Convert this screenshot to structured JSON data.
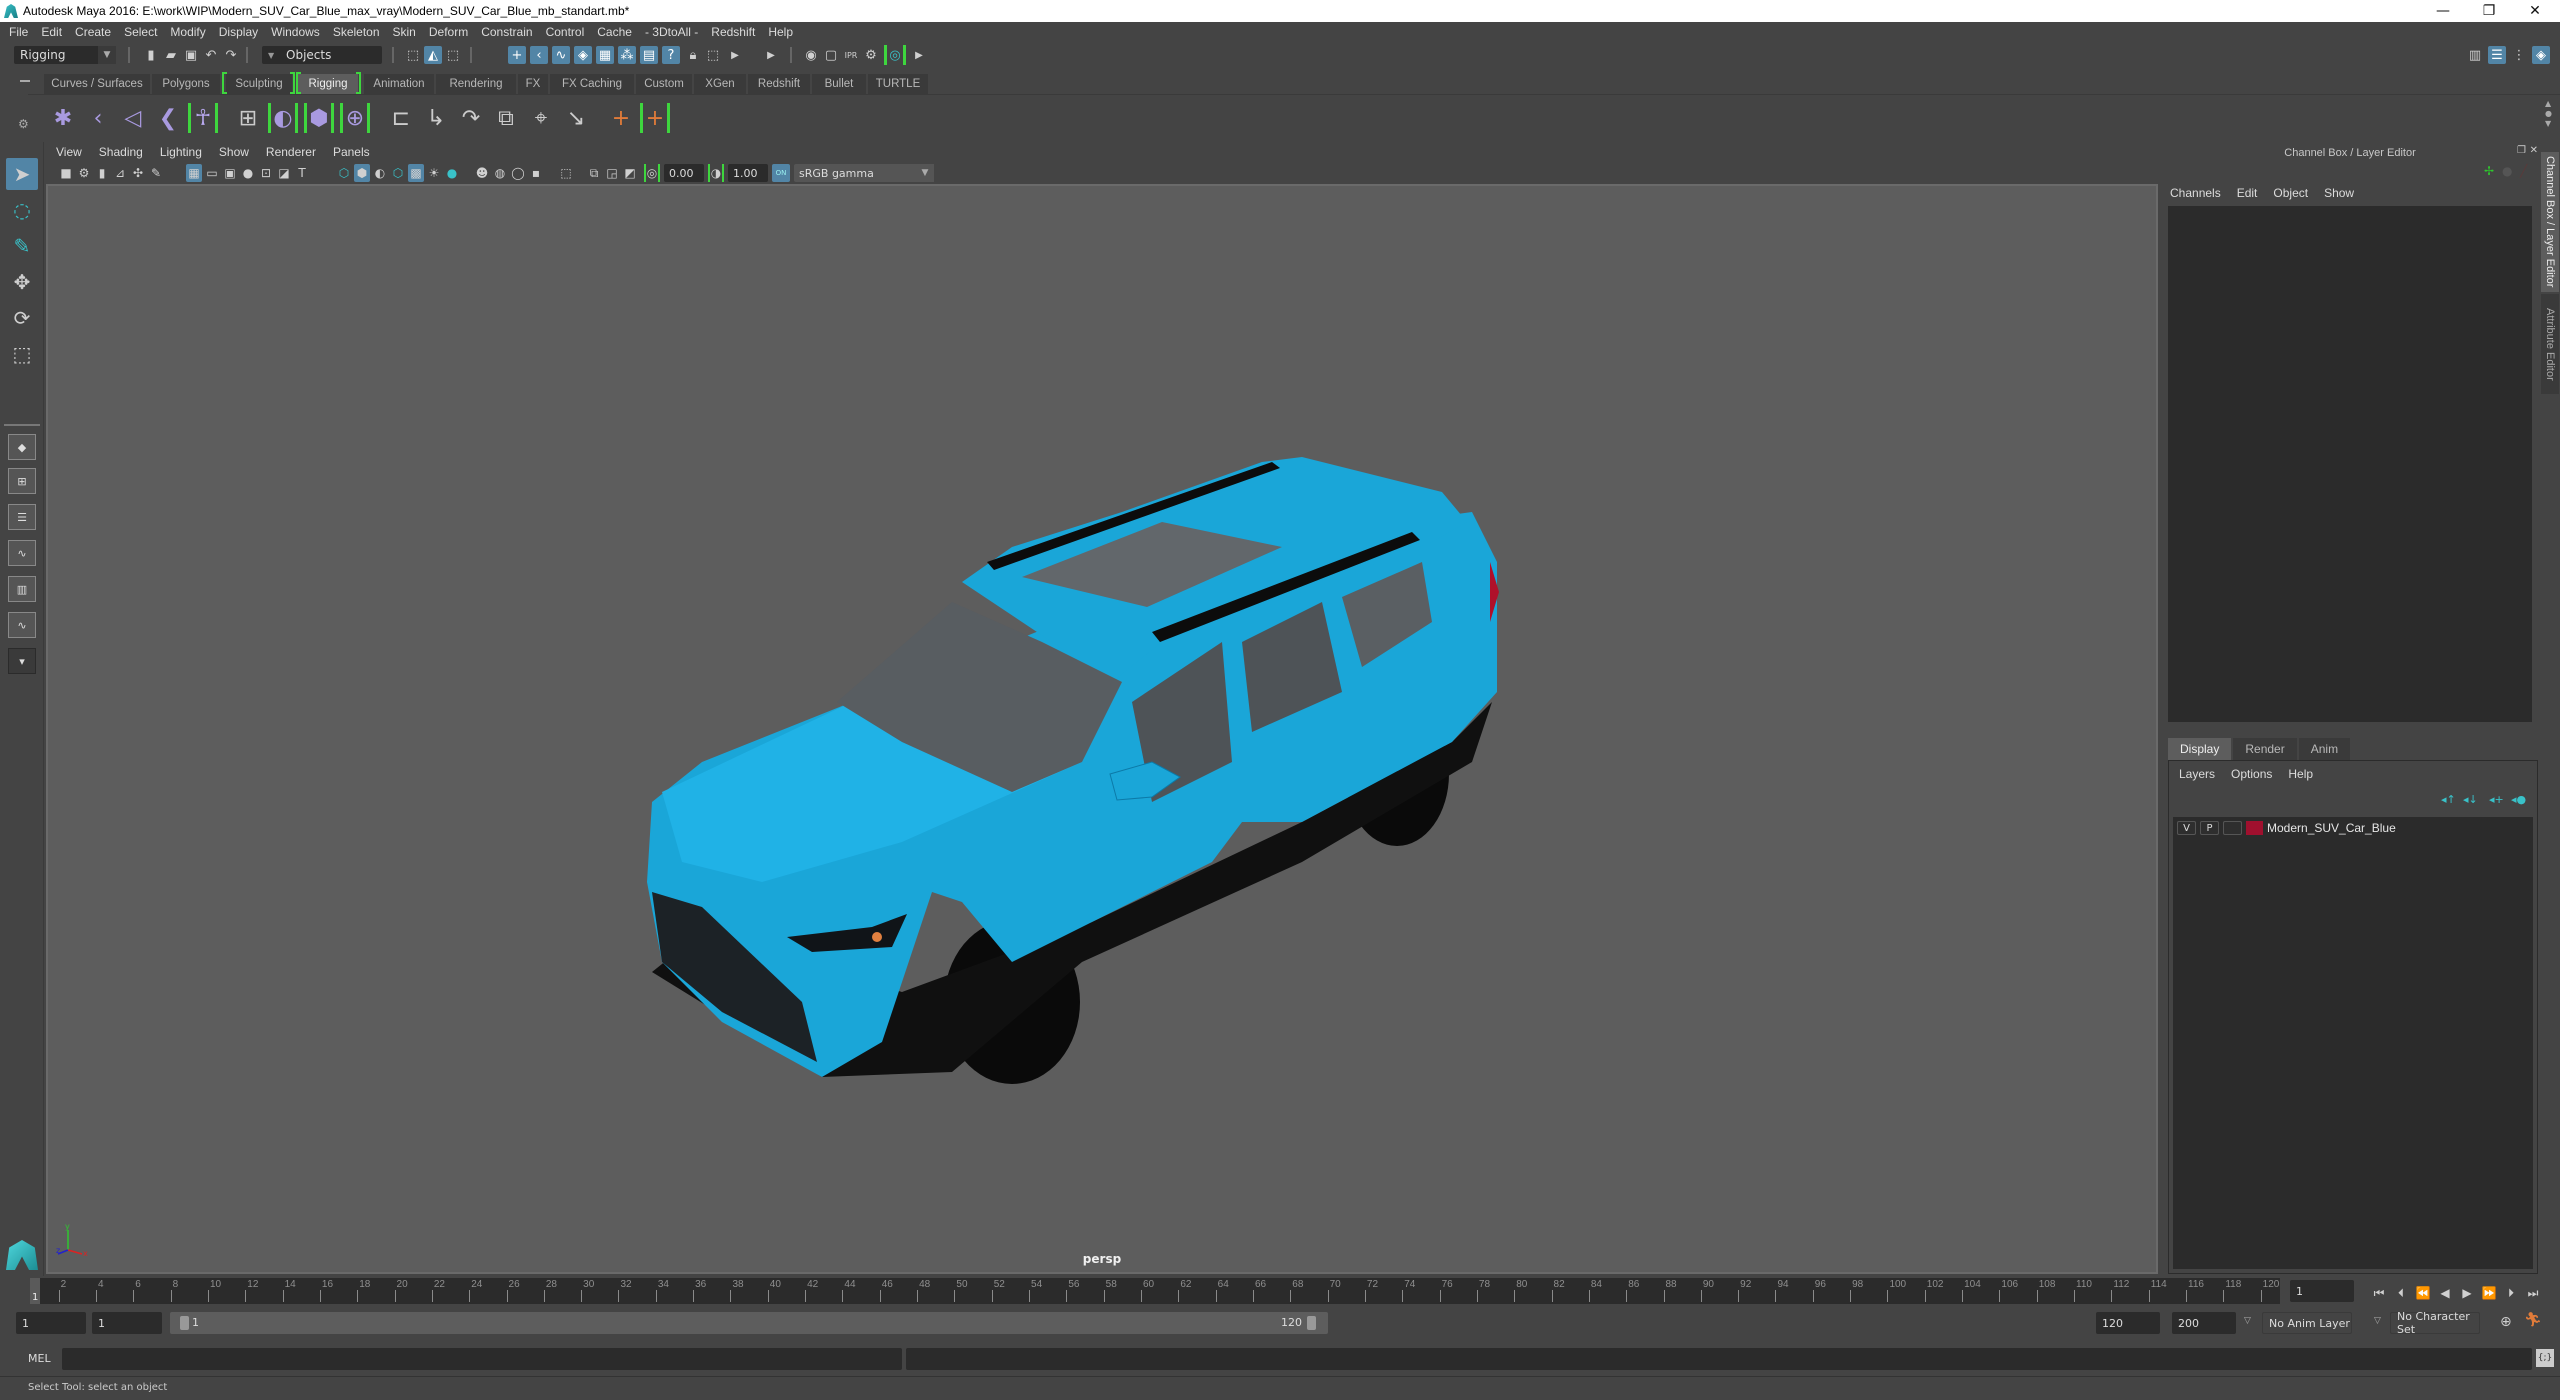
{
  "window": {
    "title": "Autodesk Maya 2016: E:\\work\\WIP\\Modern_SUV_Car_Blue_max_vray\\Modern_SUV_Car_Blue_mb_standart.mb*",
    "minimize": "—",
    "restore": "❐",
    "close": "✕"
  },
  "menubar": [
    "File",
    "Edit",
    "Create",
    "Select",
    "Modify",
    "Display",
    "Windows",
    "Skeleton",
    "Skin",
    "Deform",
    "Constrain",
    "Control",
    "Cache",
    "- 3DtoAll -",
    "Redshift",
    "Help"
  ],
  "statusline": {
    "menuset": "Rigging",
    "selection_mode": "Objects"
  },
  "shelf_tabs": [
    {
      "label": "Curves / Surfaces",
      "active": false
    },
    {
      "label": "Polygons",
      "active": false
    },
    {
      "label": "Sculpting",
      "active": false
    },
    {
      "label": "Rigging",
      "active": true
    },
    {
      "label": "Animation",
      "active": false
    },
    {
      "label": "Rendering",
      "active": false
    },
    {
      "label": "FX",
      "active": false
    },
    {
      "label": "FX Caching",
      "active": false
    },
    {
      "label": "Custom",
      "active": false
    },
    {
      "label": "XGen",
      "active": false
    },
    {
      "label": "Redshift",
      "active": false
    },
    {
      "label": "Bullet",
      "active": false
    },
    {
      "label": "TURTLE",
      "active": false
    }
  ],
  "shelf_icons": [
    "joint-tool-icon",
    "ik-handle-icon",
    "ik-spline-icon",
    "insert-joint-icon",
    "humanik-icon",
    "paint-skin-weights-icon",
    "bind-skin-icon",
    "lattice-icon",
    "cluster-icon",
    "parent-constraint-icon",
    "point-constraint-icon",
    "orient-constraint-icon",
    "scale-constraint-icon",
    "aim-constraint-icon",
    "pole-vector-icon",
    "locator-icon",
    "constraint-link-icon"
  ],
  "viewport": {
    "menus": [
      "View",
      "Shading",
      "Lighting",
      "Show",
      "Renderer",
      "Panels"
    ],
    "exposure": "0.00",
    "gamma": "1.00",
    "color_management": "ON",
    "colorspace": "sRGB gamma",
    "camera": "persp",
    "axis": {
      "x": "x",
      "y": "y",
      "z": "z"
    },
    "model_colors": {
      "body": "#1aa6d8",
      "glass": "#5a5f63",
      "tire": "#0a0a0a"
    }
  },
  "right_panel": {
    "header": "Channel Box / Layer Editor",
    "channel_menus": [
      "Channels",
      "Edit",
      "Object",
      "Show"
    ],
    "layer_tabs": [
      {
        "label": "Display",
        "active": true
      },
      {
        "label": "Render",
        "active": false
      },
      {
        "label": "Anim",
        "active": false
      }
    ],
    "layer_menus": [
      "Layers",
      "Options",
      "Help"
    ],
    "layers": [
      {
        "visible": "V",
        "playback": "P",
        "color": "#a0102e",
        "name": "Modern_SUV_Car_Blue"
      }
    ],
    "side_tabs": [
      "Channel Box / Layer Editor",
      "Attribute Editor"
    ]
  },
  "timeline": {
    "tick_labels": [
      2,
      4,
      6,
      8,
      10,
      12,
      14,
      16,
      18,
      20,
      22,
      24,
      26,
      28,
      30,
      32,
      34,
      36,
      38,
      40,
      42,
      44,
      46,
      48,
      50,
      52,
      54,
      56,
      58,
      60,
      62,
      64,
      66,
      68,
      70,
      72,
      74,
      76,
      78,
      80,
      82,
      84,
      86,
      88,
      90,
      92,
      94,
      96,
      98,
      100,
      102,
      104,
      106,
      108,
      110,
      112,
      114,
      116,
      118,
      120
    ],
    "current_frame_marker": "1",
    "current_frame": "1",
    "range_start": "1",
    "playback_start": "1",
    "slider_start": "1",
    "slider_end": "120",
    "playback_end": "120",
    "range_end": "200",
    "anim_layer": "No Anim Layer",
    "character_set": "No Character Set"
  },
  "command_line": {
    "label": "MEL",
    "help_text": "Select Tool: select an object"
  },
  "colors": {
    "accent": "#5285a6",
    "highlight_green": "#3ed63e",
    "maya_teal": "#39c2c9"
  }
}
